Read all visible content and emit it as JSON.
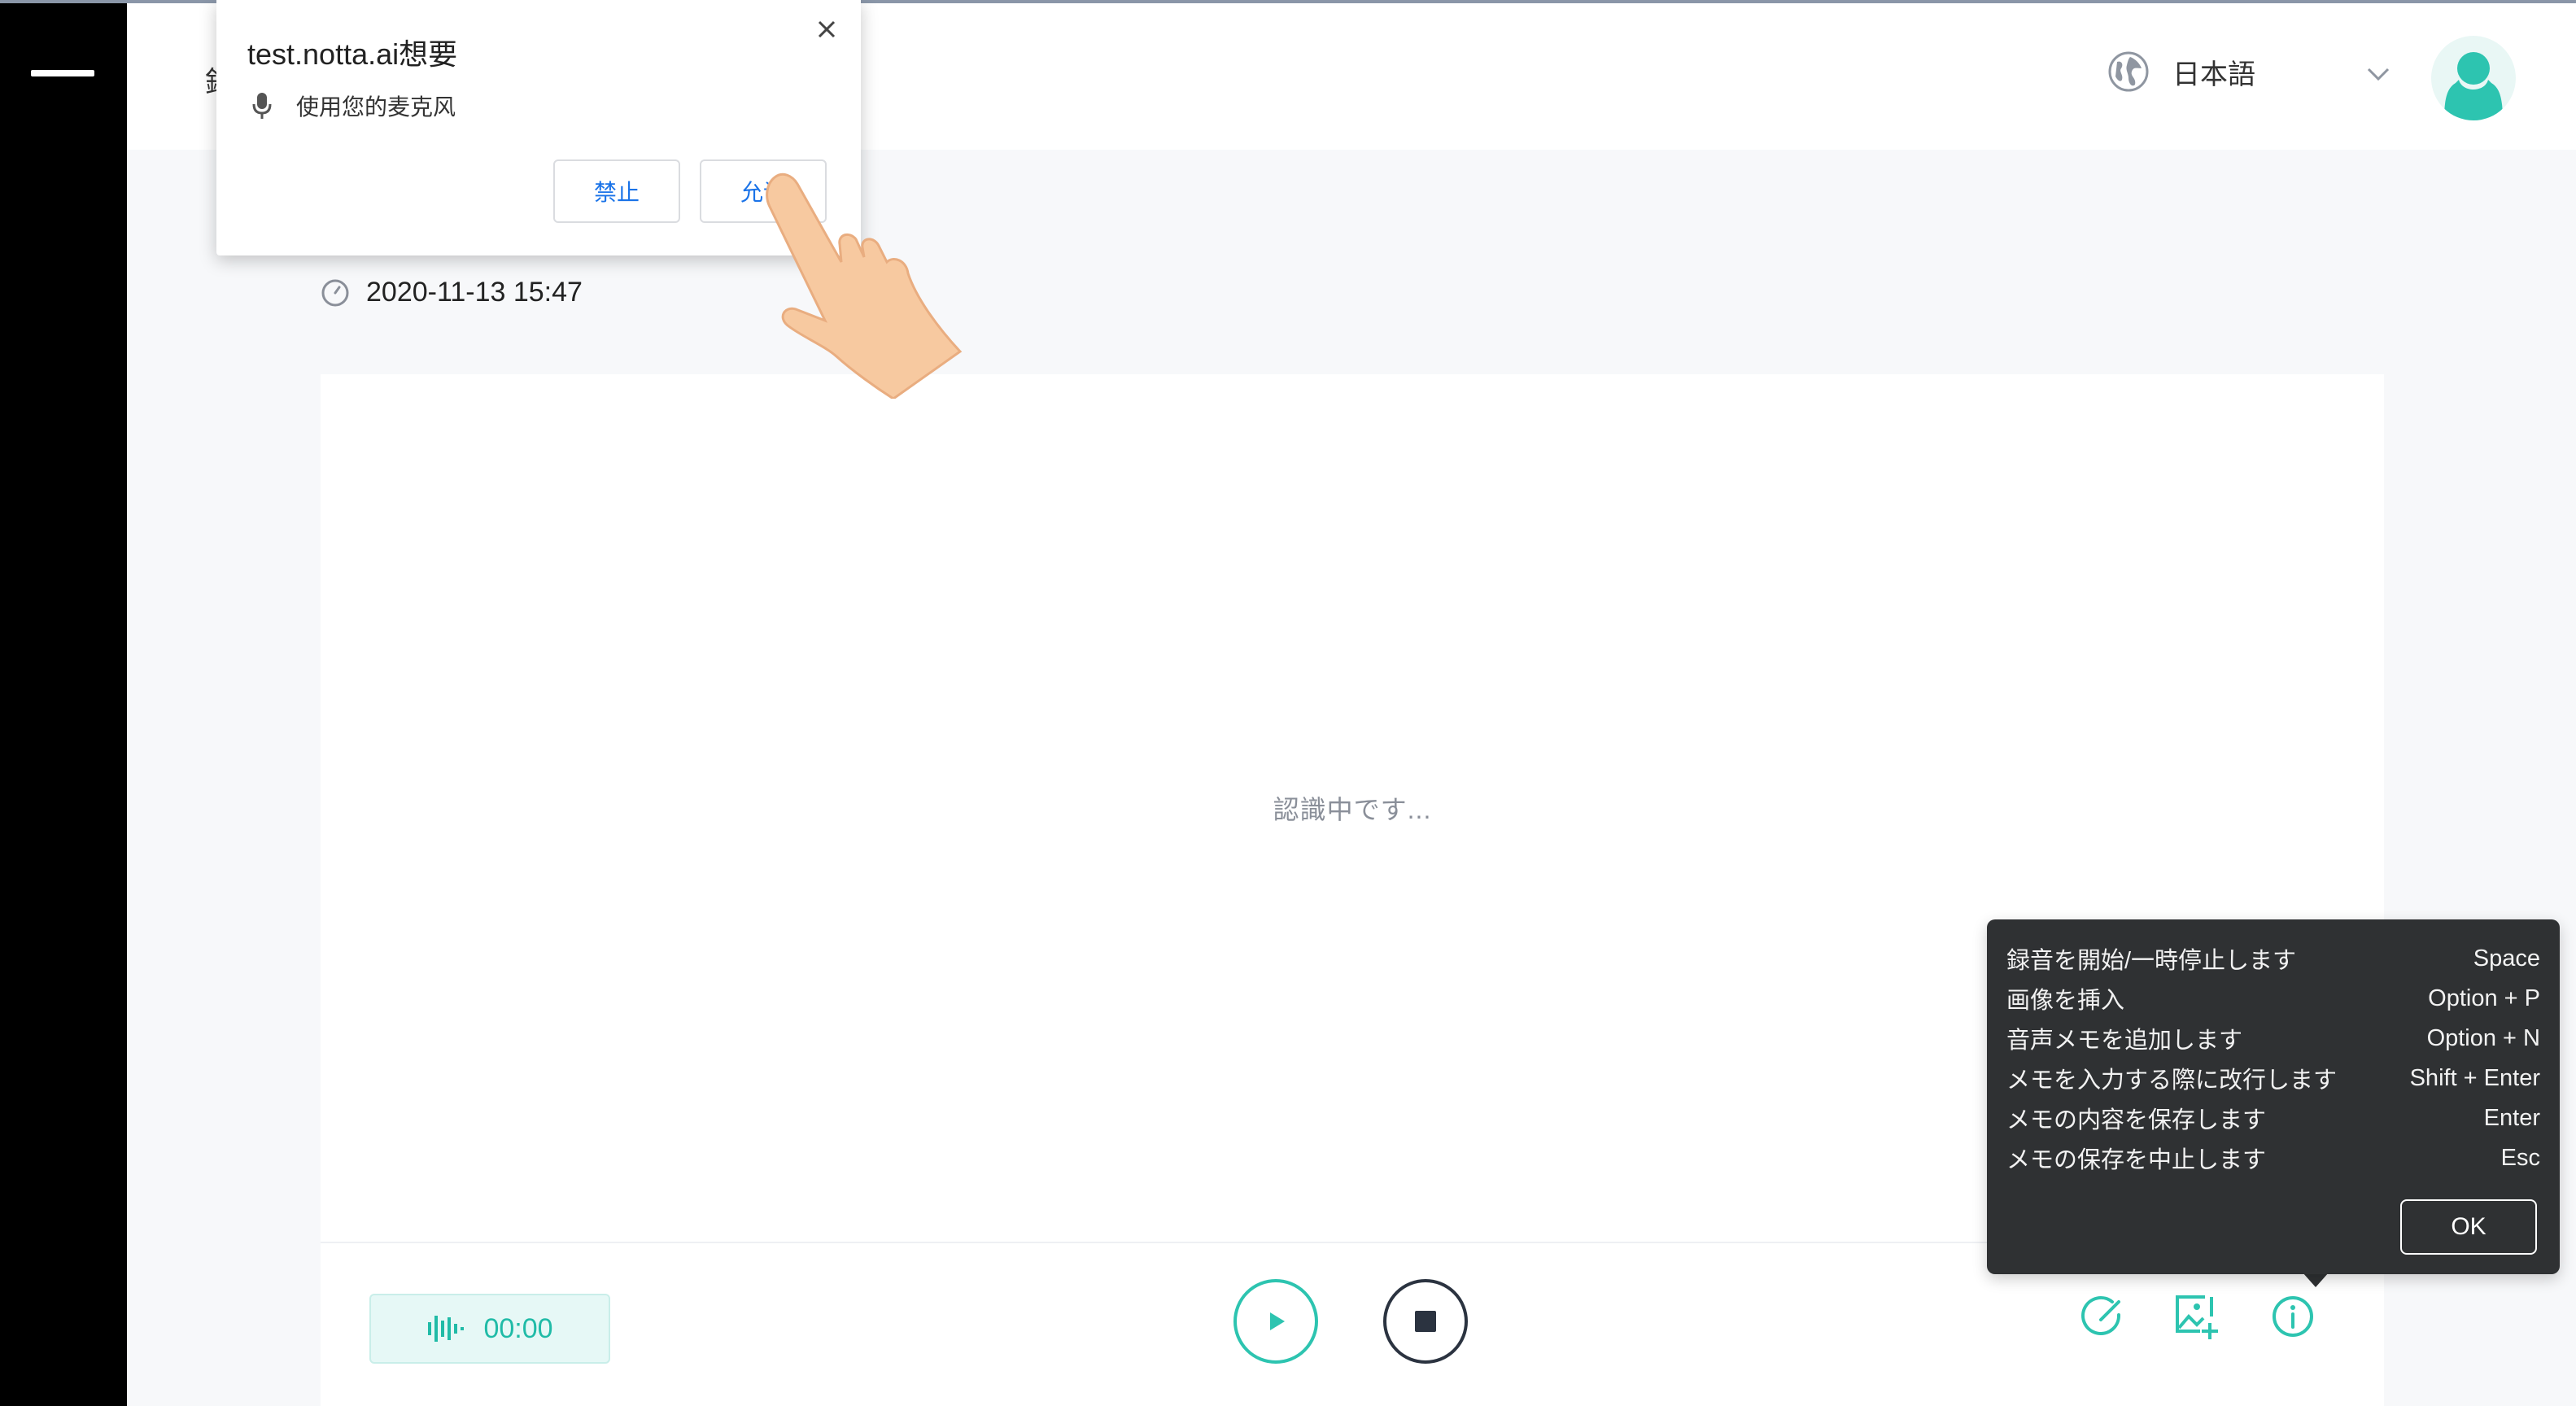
{
  "header": {
    "title_stub": "録",
    "language": "日本語"
  },
  "note": {
    "date": "2020-11-13 15:47",
    "status_text": "認識中です..."
  },
  "recorder": {
    "elapsed": "00:00"
  },
  "permission_prompt": {
    "title": "test.notta.ai想要",
    "permission": "使用您的麦克风",
    "deny_label": "禁止",
    "allow_label": "允许"
  },
  "shortcuts_tooltip": {
    "rows": [
      {
        "action": "録音を開始/一時停止します",
        "key": "Space"
      },
      {
        "action": "画像を挿入",
        "key": "Option + P"
      },
      {
        "action": "音声メモを追加します",
        "key": "Option + N"
      },
      {
        "action": "メモを入力する際に改行します",
        "key": "Shift + Enter"
      },
      {
        "action": "メモの内容を保存します",
        "key": "Enter"
      },
      {
        "action": "メモの保存を中止します",
        "key": "Esc"
      }
    ],
    "ok_label": "OK"
  },
  "colors": {
    "accent": "#2dc4b0",
    "sidebar": "#000000",
    "tooltip_bg": "#2f3133",
    "link_blue": "#1a73e8"
  },
  "icons": [
    "hamburger-icon",
    "globe-icon",
    "chevron-down-icon",
    "avatar-icon",
    "clock-icon",
    "waveform-icon",
    "play-icon",
    "stop-icon",
    "edit-note-icon",
    "insert-image-icon",
    "info-icon",
    "microphone-icon",
    "close-icon",
    "pointing-hand"
  ]
}
